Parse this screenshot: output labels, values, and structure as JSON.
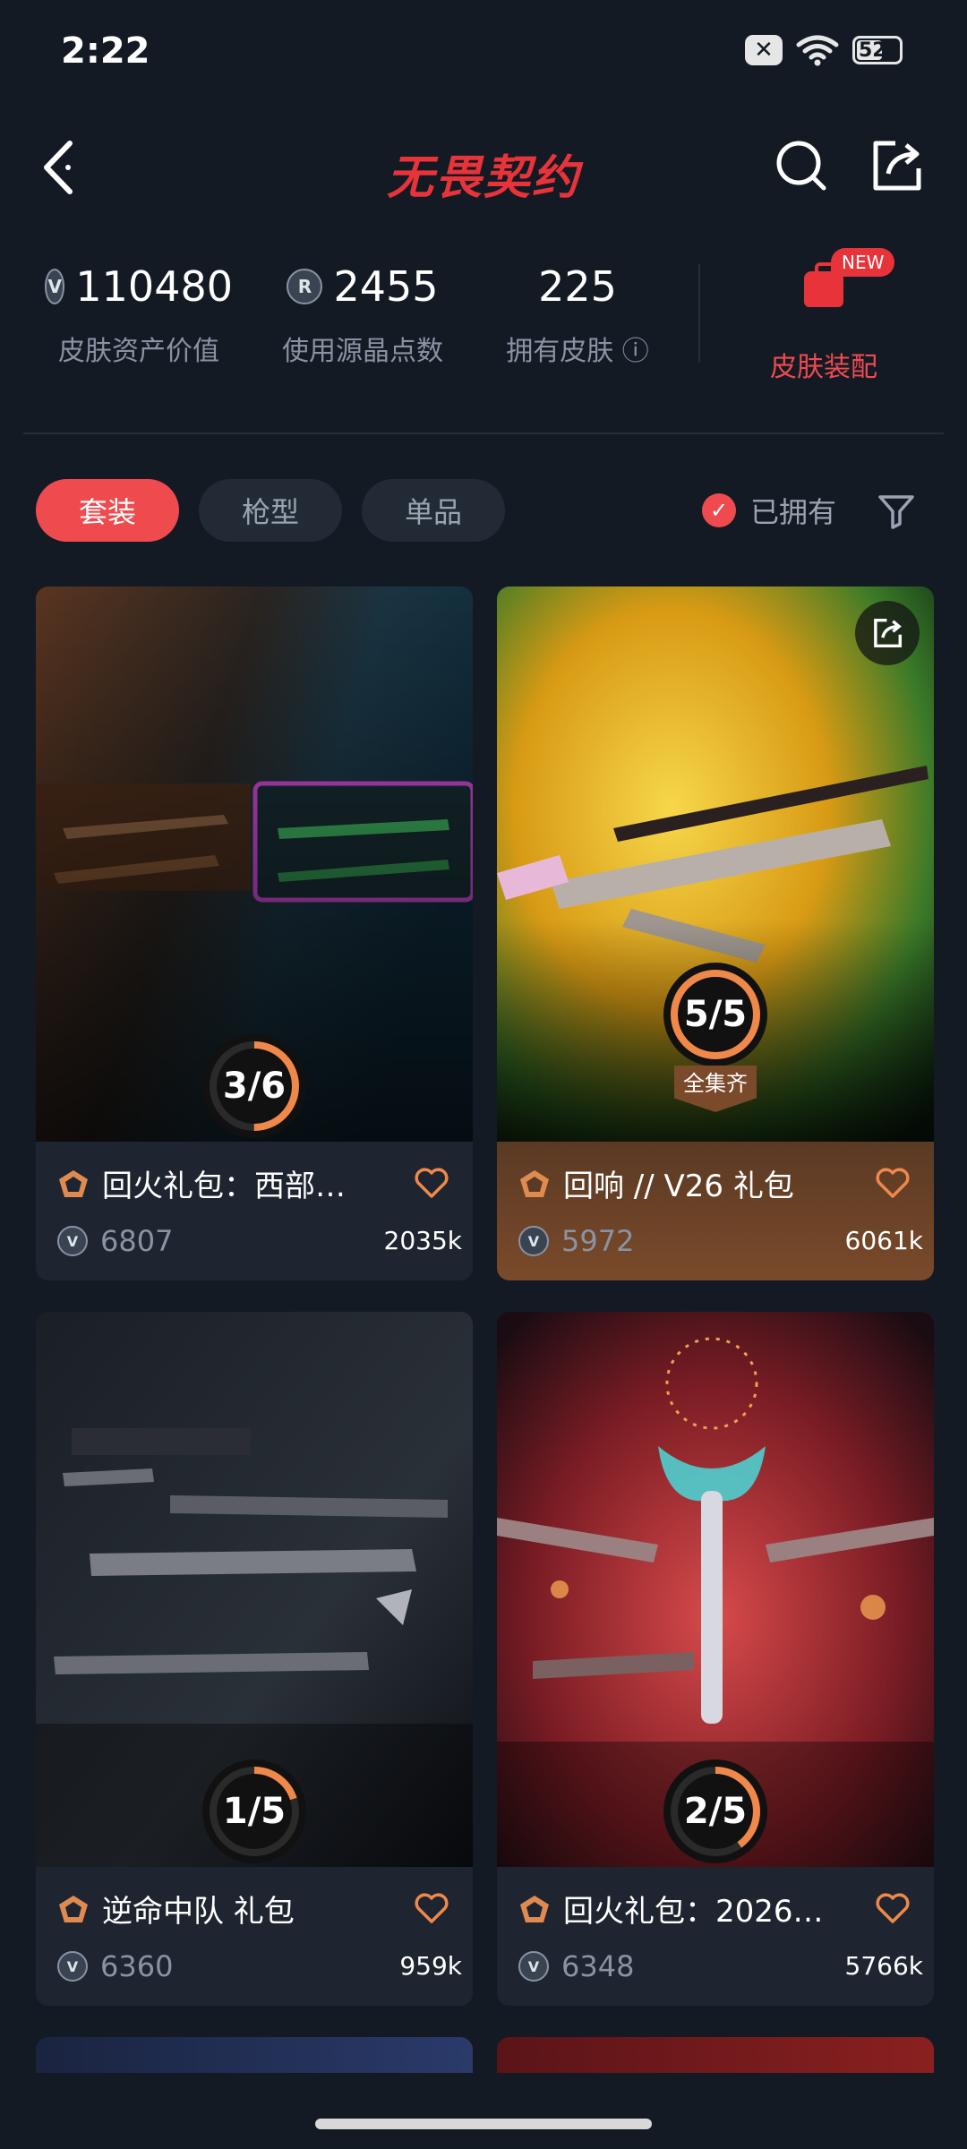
{
  "status_bar": {
    "time": "2:22",
    "battery": "52",
    "x_badge": "✕"
  },
  "header": {
    "title": "无畏契约"
  },
  "stats": [
    {
      "value": "110480",
      "label": "皮肤资产价值",
      "icon": "vp-coin-icon"
    },
    {
      "value": "2455",
      "label": "使用源晶点数",
      "icon": "radianite-icon"
    },
    {
      "value": "225",
      "label": "拥有皮肤 ⓘ"
    }
  ],
  "outfit": {
    "label": "皮肤装配",
    "badge": "NEW"
  },
  "filters": {
    "tabs": [
      "套装",
      "枪型",
      "单品"
    ],
    "owned_label": "已拥有",
    "owned_checked": true
  },
  "cards": [
    {
      "name": "回火礼包：西部…",
      "price": "6807",
      "likes": "2035k",
      "progress": "3/6",
      "progress_fraction": 0.5
    },
    {
      "name": "回响 // V26 礼包",
      "price": "5972",
      "likes": "6061k",
      "progress": "5/5",
      "progress_fraction": 1.0,
      "tag": "全集齐"
    },
    {
      "name": "逆命中队 礼包",
      "price": "6360",
      "likes": "959k",
      "progress": "1/5",
      "progress_fraction": 0.2
    },
    {
      "name": "回火礼包：2026…",
      "price": "6348",
      "likes": "5766k",
      "progress": "2/5",
      "progress_fraction": 0.4
    }
  ],
  "colors": {
    "accent": "#ef4b4f",
    "ring": "#f0884a",
    "background": "#131a24"
  }
}
